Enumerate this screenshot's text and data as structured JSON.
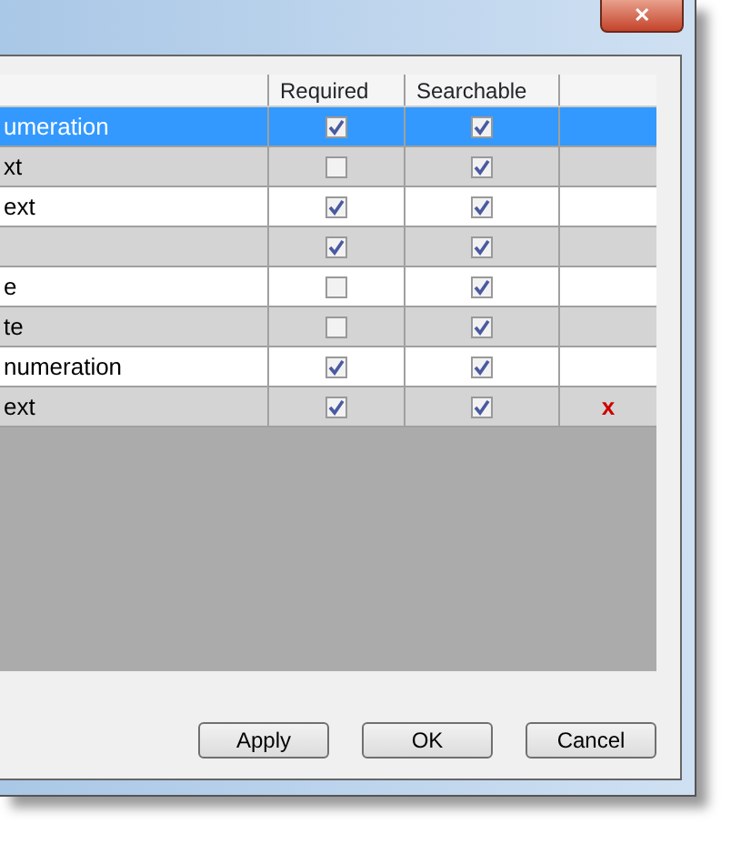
{
  "window": {
    "close": "✕"
  },
  "table": {
    "columns": [
      "Required",
      "Searchable"
    ],
    "rows": [
      {
        "name": "umeration",
        "required": true,
        "searchable": true,
        "selected": true
      },
      {
        "name": "xt",
        "required": false,
        "searchable": true,
        "selected": false
      },
      {
        "name": "ext",
        "required": true,
        "searchable": true,
        "selected": false
      },
      {
        "required": true,
        "searchable": true,
        "selected": false
      },
      {
        "name": "e",
        "required": false,
        "searchable": true,
        "selected": false
      },
      {
        "name": "te",
        "required": false,
        "searchable": true,
        "selected": false
      },
      {
        "name": "numeration",
        "required": true,
        "searchable": true,
        "selected": false
      },
      {
        "name": "ext",
        "required": true,
        "searchable": true,
        "selected": false,
        "remove": "x"
      }
    ]
  },
  "buttons": [
    "Apply",
    "OK",
    "Cancel"
  ]
}
